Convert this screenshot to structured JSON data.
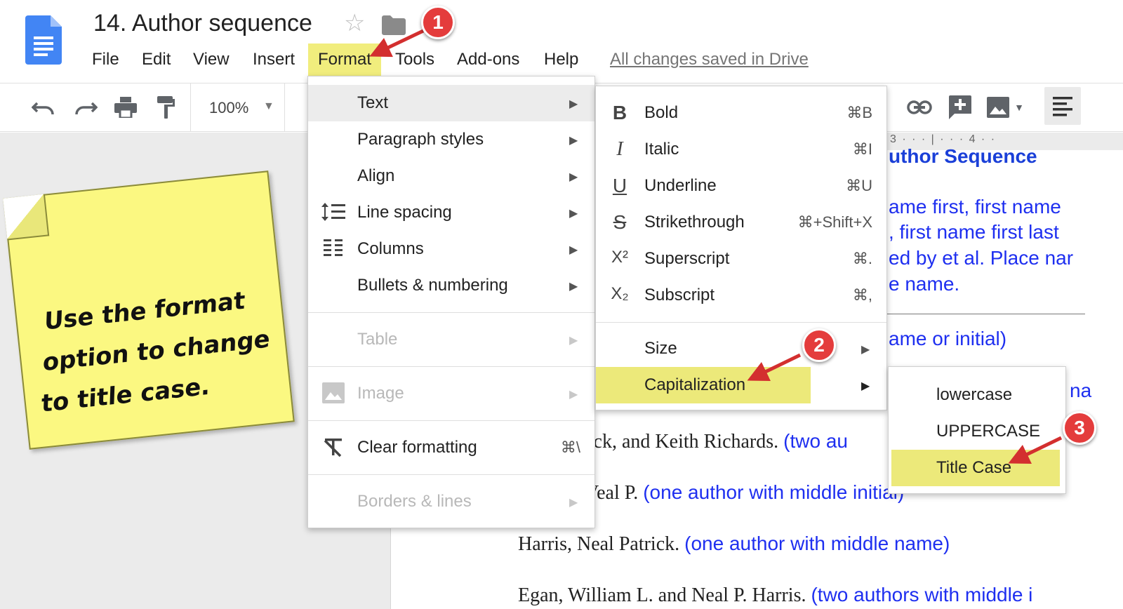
{
  "document": {
    "title": "14. Author sequence",
    "saved_status": "All changes saved in Drive"
  },
  "menubar": [
    {
      "label": "File"
    },
    {
      "label": "Edit"
    },
    {
      "label": "View"
    },
    {
      "label": "Insert"
    },
    {
      "label": "Format",
      "active": true
    },
    {
      "label": "Tools"
    },
    {
      "label": "Add-ons"
    },
    {
      "label": "Help"
    }
  ],
  "toolbar": {
    "zoom": "100%",
    "icons": [
      "undo-icon",
      "redo-icon",
      "print-icon",
      "paint-format-icon",
      "link-icon",
      "insert-comment-icon",
      "insert-image-icon",
      "align-left-icon"
    ]
  },
  "format_menu": {
    "items": [
      {
        "label": "Text",
        "icon": "",
        "submenu": true,
        "state": "hover"
      },
      {
        "label": "Paragraph styles",
        "submenu": true
      },
      {
        "label": "Align",
        "submenu": true
      },
      {
        "label": "Line spacing",
        "icon": "line-spacing-icon",
        "submenu": true
      },
      {
        "label": "Columns",
        "icon": "columns-icon",
        "submenu": true
      },
      {
        "label": "Bullets & numbering",
        "submenu": true
      },
      {
        "label": "Table",
        "submenu": true,
        "disabled": true
      },
      {
        "label": "Image",
        "icon": "image-icon",
        "submenu": true,
        "disabled": true
      },
      {
        "label": "Clear formatting",
        "icon": "clear-formatting-icon",
        "shortcut": "⌘\\"
      },
      {
        "label": "Borders & lines",
        "submenu": true,
        "disabled": true
      }
    ]
  },
  "text_menu": {
    "items": [
      {
        "label": "Bold",
        "icon": "bold-icon",
        "glyph": "B",
        "shortcut": "⌘B"
      },
      {
        "label": "Italic",
        "icon": "italic-icon",
        "glyph": "I",
        "shortcut": "⌘I"
      },
      {
        "label": "Underline",
        "icon": "underline-icon",
        "glyph": "U",
        "shortcut": "⌘U"
      },
      {
        "label": "Strikethrough",
        "icon": "strikethrough-icon",
        "glyph": "S",
        "shortcut": "⌘+Shift+X"
      },
      {
        "label": "Superscript",
        "icon": "superscript-icon",
        "glyph": "X²",
        "shortcut": "⌘."
      },
      {
        "label": "Subscript",
        "icon": "subscript-icon",
        "glyph": "X₂",
        "shortcut": "⌘,"
      },
      {
        "label": "Size",
        "submenu": true
      },
      {
        "label": "Capitalization",
        "submenu": true,
        "state": "highlighted"
      }
    ]
  },
  "capitalization_menu": {
    "items": [
      {
        "label": "lowercase"
      },
      {
        "label": "UPPERCASE"
      },
      {
        "label": "Title Case",
        "state": "highlighted"
      }
    ]
  },
  "sticky_note": {
    "text": "Use the format option to change to title case."
  },
  "markers": [
    "1",
    "2",
    "3"
  ],
  "document_body": {
    "ruler": "3 · · · | · · · 4 · ·",
    "heading_fragment": "uthor Sequence",
    "lines_blue": [
      "ame first, first name",
      ", first name first last",
      "ed by et al. Place nar",
      "e name.",
      "ame or initial)",
      "na"
    ],
    "entries": [
      {
        "text": "lick, and Keith Richards. ",
        "note": "(two au"
      },
      {
        "text": "Veal P.  ",
        "note": "(one author with middle initial)"
      },
      {
        "text": "Harris, Neal Patrick. ",
        "note": "(one author with middle name)"
      },
      {
        "text": "Egan, William L. and Neal P. Harris. ",
        "note": "(two authors with middle i"
      }
    ]
  },
  "colors": {
    "highlight": "#ece97a",
    "marker": "#e43c3c",
    "link_blue": "#1e2ff0",
    "sticky": "#fbf881"
  }
}
